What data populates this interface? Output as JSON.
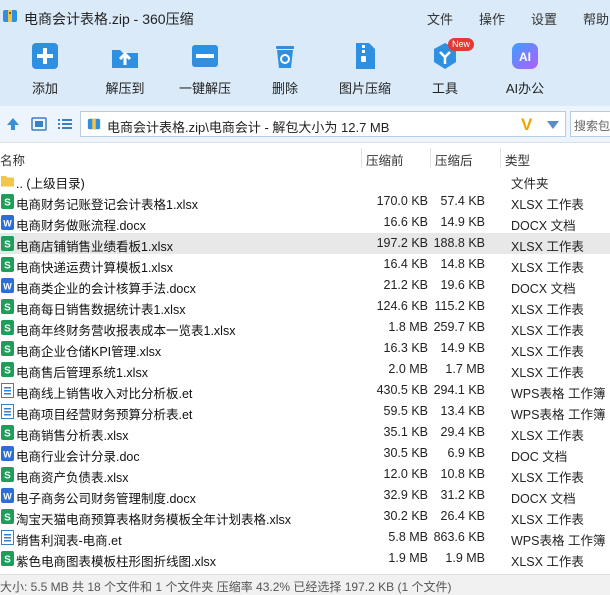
{
  "window": {
    "title": "电商会计表格.zip - 360压缩"
  },
  "menu": [
    {
      "label": "文件"
    },
    {
      "label": "操作"
    },
    {
      "label": "设置"
    },
    {
      "label": "帮助"
    }
  ],
  "toolbar": {
    "add": "添加",
    "extract_to": "解压到",
    "one_click": "一键解压",
    "delete": "删除",
    "image_compress": "图片压缩",
    "tools": "工具",
    "tools_badge": "New",
    "ai_office": "AI办公"
  },
  "address": {
    "path": "电商会计表格.zip\\电商会计 - 解包大小为 12.7 MB",
    "search_placeholder": "搜索包"
  },
  "columns": {
    "name": "名称",
    "size": "压缩前",
    "packed": "压缩后",
    "type": "类型"
  },
  "files": [
    {
      "name": ".. (上级目录)",
      "size": "",
      "packed": "",
      "type": "文件夹",
      "kind": "folder"
    },
    {
      "name": "电商财务记账登记会计表格1.xlsx",
      "size": "170.0 KB",
      "packed": "57.4 KB",
      "type": "XLSX 工作表",
      "kind": "xlsx"
    },
    {
      "name": "电商财务做账流程.docx",
      "size": "16.6 KB",
      "packed": "14.9 KB",
      "type": "DOCX 文档",
      "kind": "docx"
    },
    {
      "name": "电商店铺销售业绩看板1.xlsx",
      "size": "197.2 KB",
      "packed": "188.8 KB",
      "type": "XLSX 工作表",
      "kind": "xlsx",
      "selected": true
    },
    {
      "name": "电商快递运费计算模板1.xlsx",
      "size": "16.4 KB",
      "packed": "14.8 KB",
      "type": "XLSX 工作表",
      "kind": "xlsx"
    },
    {
      "name": "电商类企业的会计核算手法.docx",
      "size": "21.2 KB",
      "packed": "19.6 KB",
      "type": "DOCX 文档",
      "kind": "docx"
    },
    {
      "name": "电商每日销售数据统计表1.xlsx",
      "size": "124.6 KB",
      "packed": "115.2 KB",
      "type": "XLSX 工作表",
      "kind": "xlsx"
    },
    {
      "name": "电商年终财务营收报表成本一览表1.xlsx",
      "size": "1.8 MB",
      "packed": "259.7 KB",
      "type": "XLSX 工作表",
      "kind": "xlsx"
    },
    {
      "name": "电商企业仓储KPI管理.xlsx",
      "size": "16.3 KB",
      "packed": "14.9 KB",
      "type": "XLSX 工作表",
      "kind": "xlsx"
    },
    {
      "name": "电商售后管理系统1.xlsx",
      "size": "2.0 MB",
      "packed": "1.7 MB",
      "type": "XLSX 工作表",
      "kind": "xlsx"
    },
    {
      "name": "电商线上销售收入对比分析板.et",
      "size": "430.5 KB",
      "packed": "294.1 KB",
      "type": "WPS表格 工作簿",
      "kind": "et"
    },
    {
      "name": "电商项目经营财务预算分析表.et",
      "size": "59.5 KB",
      "packed": "13.4 KB",
      "type": "WPS表格 工作簿",
      "kind": "et"
    },
    {
      "name": "电商销售分析表.xlsx",
      "size": "35.1 KB",
      "packed": "29.4 KB",
      "type": "XLSX 工作表",
      "kind": "xlsx"
    },
    {
      "name": "电商行业会计分录.doc",
      "size": "30.5 KB",
      "packed": "6.9 KB",
      "type": "DOC 文档",
      "kind": "docx"
    },
    {
      "name": "电商资产负债表.xlsx",
      "size": "12.0 KB",
      "packed": "10.8 KB",
      "type": "XLSX 工作表",
      "kind": "xlsx"
    },
    {
      "name": "电子商务公司财务管理制度.docx",
      "size": "32.9 KB",
      "packed": "31.2 KB",
      "type": "DOCX 文档",
      "kind": "docx"
    },
    {
      "name": "淘宝天猫电商预算表格财务模板全年计划表格.xlsx",
      "size": "30.2 KB",
      "packed": "26.4 KB",
      "type": "XLSX 工作表",
      "kind": "xlsx"
    },
    {
      "name": "销售利润表-电商.et",
      "size": "5.8 MB",
      "packed": "863.6 KB",
      "type": "WPS表格 工作簿",
      "kind": "et"
    },
    {
      "name": "紫色电商图表模板柱形图折线图.xlsx",
      "size": "1.9 MB",
      "packed": "1.9 MB",
      "type": "XLSX 工作表",
      "kind": "xlsx"
    }
  ],
  "status": "大小: 5.5 MB 共 18 个文件和 1 个文件夹 压缩率 43.2% 已经选择 197.2 KB (1 个文件)",
  "colors": {
    "toolbar_bg": "#dbeaf9",
    "icon_blue": "#2f8fe0",
    "xlsx_green": "#1e9e5a",
    "docx_blue": "#2b6fd6",
    "selected_row": "#e8e8e8"
  }
}
